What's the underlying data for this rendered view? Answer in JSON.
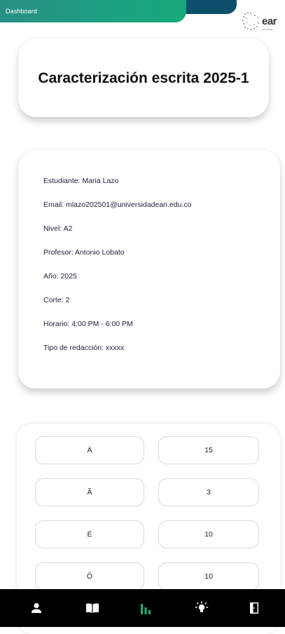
{
  "header": {
    "title": "Dashboard",
    "logo_text": "ear",
    "logo_subtext": "universidad",
    "colors": {
      "primary_bar": "#1aa57f",
      "secondary_bar": "#0e4f6b"
    }
  },
  "title_card": {
    "title": "Caracterización escrita 2025-1"
  },
  "info": {
    "student": "Estudiante: Maria Lazo",
    "email": "Email: mlazo202501@universidadean.edu.co",
    "level": "Nivel: A2",
    "teacher": "Profesor: Antonio Lobato",
    "year": "Año: 2025",
    "term": "Corte: 2",
    "schedule": "Horario: 4:00 PM - 6:00 PM",
    "writing_type": "Tipo de redacción: xxxxx"
  },
  "stats": [
    {
      "char": "Á",
      "count": "15"
    },
    {
      "char": "Ã",
      "count": "3"
    },
    {
      "char": "É",
      "count": "10"
    },
    {
      "char": "Ô",
      "count": "10"
    }
  ],
  "bottom_nav": {
    "items": [
      {
        "icon": "person-icon"
      },
      {
        "icon": "book-open-icon"
      },
      {
        "icon": "bar-chart-icon",
        "active": true,
        "color": "#1fb36b"
      },
      {
        "icon": "lightbulb-icon"
      },
      {
        "icon": "logout-door-icon"
      }
    ]
  }
}
